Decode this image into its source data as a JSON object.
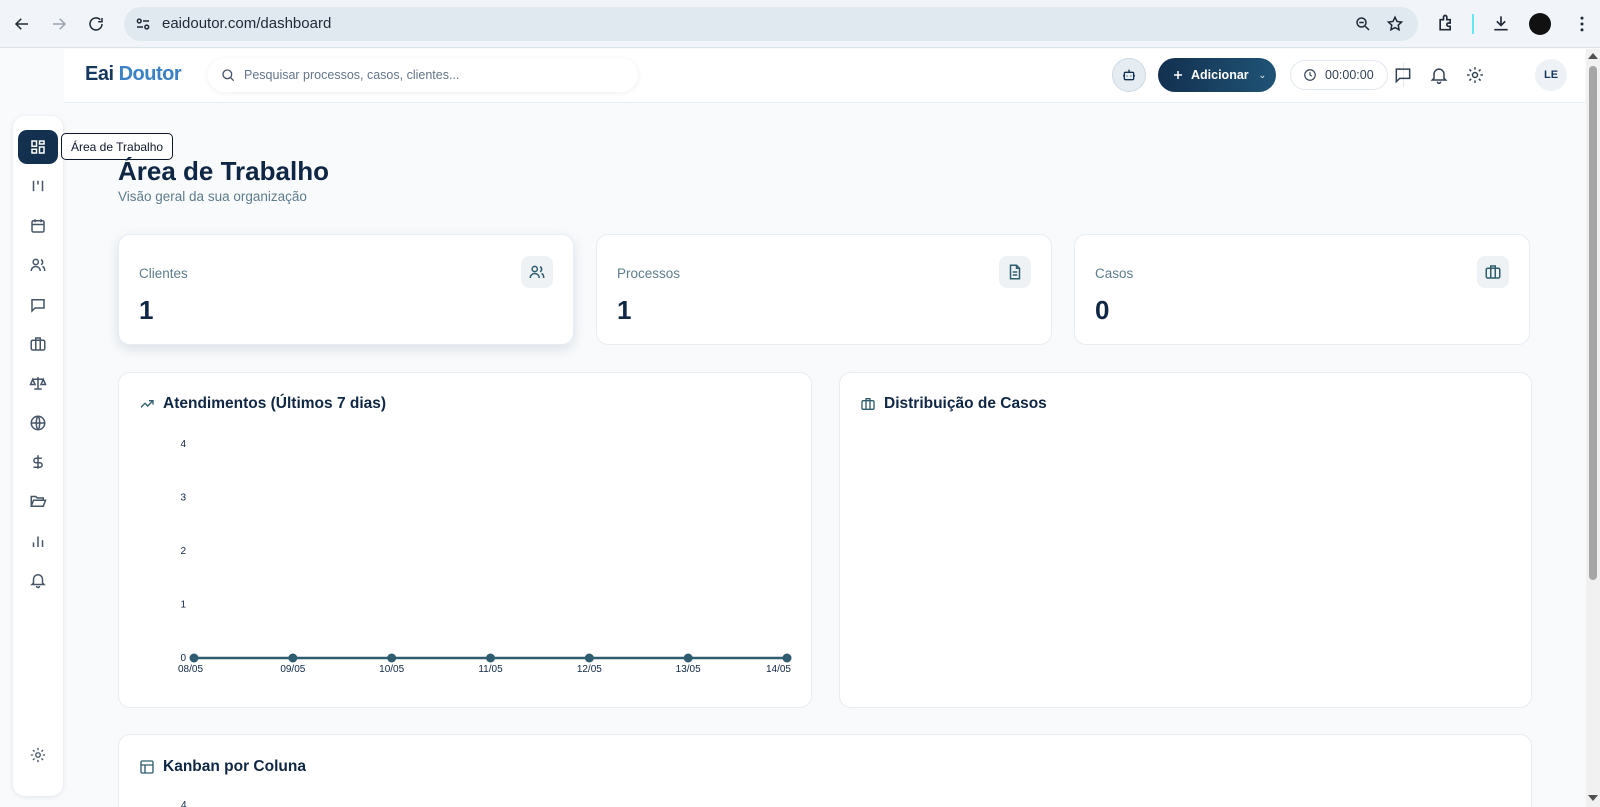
{
  "browser": {
    "url": "eaidoutor.com/dashboard"
  },
  "header": {
    "logo_part1": "Eai",
    "logo_part2": "Doutor",
    "search_placeholder": "Pesquisar processos, casos, clientes...",
    "add_label": "Adicionar",
    "timer": "00:00:00",
    "avatar_initials": "LE"
  },
  "sidebar": {
    "tooltip": "Área de Trabalho",
    "items": [
      {
        "icon": "dashboard-icon",
        "active": true
      },
      {
        "icon": "kanban-icon"
      },
      {
        "icon": "calendar-icon"
      },
      {
        "icon": "users-icon"
      },
      {
        "icon": "chat-icon"
      },
      {
        "icon": "briefcase-icon"
      },
      {
        "icon": "scale-icon"
      },
      {
        "icon": "globe-icon"
      },
      {
        "icon": "dollar-icon"
      },
      {
        "icon": "folder-open-icon"
      },
      {
        "icon": "bar-chart-icon"
      },
      {
        "icon": "bell-icon"
      },
      {
        "icon": "gear-icon"
      }
    ]
  },
  "main": {
    "title": "Área de Trabalho",
    "subtitle": "Visão geral da sua organização",
    "stats": [
      {
        "label": "Clientes",
        "value": "1",
        "icon": "users-icon"
      },
      {
        "label": "Processos",
        "value": "1",
        "icon": "file-text-icon"
      },
      {
        "label": "Casos",
        "value": "0",
        "icon": "briefcase-icon"
      }
    ],
    "panels": {
      "atendimentos_title": "Atendimentos (Últimos 7 dias)",
      "distribuicao_title": "Distribuição de Casos",
      "kanban_title": "Kanban por Coluna",
      "kanban_axis_top": "4"
    }
  },
  "colors": {
    "primary": "#13304f",
    "accent": "#3b82c4",
    "line": "#2f5d6f",
    "muted_text": "#5e7c8c"
  },
  "chart_data": {
    "type": "line",
    "title": "Atendimentos (Últimos 7 dias)",
    "categories": [
      "08/05",
      "09/05",
      "10/05",
      "11/05",
      "12/05",
      "13/05",
      "14/05"
    ],
    "values": [
      0,
      0,
      0,
      0,
      0,
      0,
      0
    ],
    "yticks": [
      0,
      1,
      2,
      3,
      4
    ],
    "ylim": [
      0,
      4
    ],
    "xlabel": "",
    "ylabel": "",
    "grid": false
  }
}
